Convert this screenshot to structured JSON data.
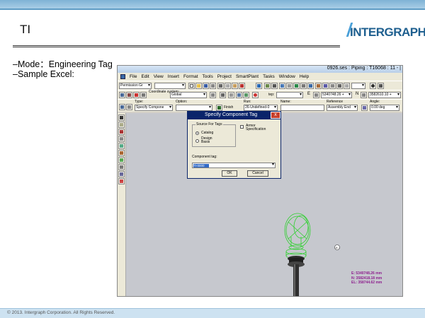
{
  "slide": {
    "title": "TI",
    "logo": "INTERGRAPH",
    "bullets": [
      "–Mode：Engineering Tag",
      "–Sample Excel:"
    ],
    "footer": "© 2013. Intergraph Corporation. All Rights Reserved."
  },
  "app": {
    "window_title": "0926.ses : Piping : T16068 : 11 - |",
    "menu": [
      "File",
      "Edit",
      "View",
      "Insert",
      "Format",
      "Tools",
      "Project",
      "SmartPlant",
      "Tasks",
      "Window",
      "Help"
    ],
    "toolbar1": {
      "permission_group": "Permission Gr",
      "coordinate_label": "Coordinate\nsystem:",
      "coordinate_system": "Global",
      "step_label": "tep:",
      "e_label": "E",
      "e_value": "5340748.26 +",
      "n_label": "N",
      "n_value": "3582610.10 +"
    },
    "toolbar2": {
      "type_label": "Type:",
      "type_value": "Specify Compone",
      "option_label": "Option:",
      "finish_label": "Finish",
      "run_label": "Run:",
      "run_value": "26-Undefined-0",
      "name_label": "Name:",
      "reference_label": "Reference",
      "reference_value": "Assembly End",
      "angle_label": "Angle:",
      "angle_value": "0.00 deg"
    },
    "dialog": {
      "title": "Specify Component Tag",
      "close": "x",
      "group_label": "Source For Tags",
      "option_catalog": "Catalog",
      "option_design_basis": "Design\nBasis",
      "armor_label": "Armor\nSpecification",
      "component_tag_label": "Component tag:",
      "component_tag_value": "TI-0000",
      "ok": "OK",
      "cancel": "Cancel"
    },
    "coordinates": {
      "e": "E: 5340748.26 mm",
      "n": "N: 3582418.18 mm",
      "el": "EL: 358744.62 mm"
    },
    "colors": {
      "dialog_caption": "#0a246a",
      "selection": "#316ac5",
      "coords": "#8e1f8e",
      "model_wire": "#2fd12f"
    }
  }
}
